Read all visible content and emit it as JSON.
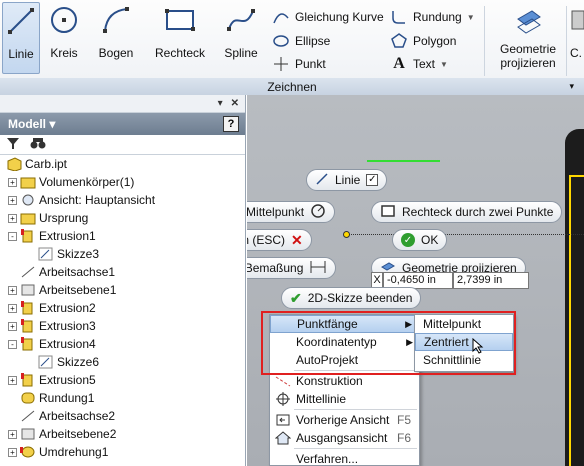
{
  "ribbon": {
    "big_buttons": [
      {
        "label": "Linie",
        "icon": "line-icon"
      },
      {
        "label": "Kreis",
        "icon": "circle-icon"
      },
      {
        "label": "Bogen",
        "icon": "arc-icon"
      },
      {
        "label": "Rechteck",
        "icon": "rectangle-icon"
      },
      {
        "label": "Spline",
        "icon": "spline-icon"
      }
    ],
    "small_buttons": [
      {
        "label": "Gleichung Kurve",
        "icon": "equation-curve-icon"
      },
      {
        "label": "Ellipse",
        "icon": "ellipse-icon"
      },
      {
        "label": "Punkt",
        "icon": "point-icon"
      },
      {
        "label": "Rundung",
        "icon": "fillet-icon"
      },
      {
        "label": "Polygon",
        "icon": "polygon-icon"
      },
      {
        "label": "Text",
        "icon": "text-icon"
      }
    ],
    "project_label_1": "Geometrie",
    "project_label_2": "projizieren",
    "cut_label": "C.",
    "panel_title": "Zeichnen"
  },
  "browser": {
    "title": "Modell",
    "tree": [
      {
        "label": "Carb.ipt",
        "icon": "part-icon",
        "level": 0,
        "expander": ""
      },
      {
        "label": "Volumenkörper(1)",
        "icon": "folder-icon",
        "level": 1,
        "expander": "+"
      },
      {
        "label": "Ansicht: Hauptansicht",
        "icon": "view-icon",
        "level": 1,
        "expander": "+"
      },
      {
        "label": "Ursprung",
        "icon": "folder-icon",
        "level": 1,
        "expander": "+"
      },
      {
        "label": "Extrusion1",
        "icon": "extrusion-icon",
        "level": 1,
        "expander": "-"
      },
      {
        "label": "Skizze3",
        "icon": "sketch-icon",
        "level": 2,
        "expander": ""
      },
      {
        "label": "Arbeitsachse1",
        "icon": "work-axis-icon",
        "level": 1,
        "expander": ""
      },
      {
        "label": "Arbeitsebene1",
        "icon": "work-plane-icon",
        "level": 1,
        "expander": "+"
      },
      {
        "label": "Extrusion2",
        "icon": "extrusion-icon",
        "level": 1,
        "expander": "+"
      },
      {
        "label": "Extrusion3",
        "icon": "extrusion-icon",
        "level": 1,
        "expander": "+"
      },
      {
        "label": "Extrusion4",
        "icon": "extrusion-icon",
        "level": 1,
        "expander": "-"
      },
      {
        "label": "Skizze6",
        "icon": "sketch-icon",
        "level": 2,
        "expander": ""
      },
      {
        "label": "Extrusion5",
        "icon": "extrusion-icon",
        "level": 1,
        "expander": "+"
      },
      {
        "label": "Rundung1",
        "icon": "fillet-feature-icon",
        "level": 1,
        "expander": ""
      },
      {
        "label": "Arbeitsachse2",
        "icon": "work-axis-icon",
        "level": 1,
        "expander": ""
      },
      {
        "label": "Arbeitsebene2",
        "icon": "work-plane-icon",
        "level": 1,
        "expander": "+"
      },
      {
        "label": "Umdrehung1",
        "icon": "revolve-icon",
        "level": 1,
        "expander": "+"
      }
    ]
  },
  "marking_menu": {
    "linie": "Linie",
    "kreis": "Kreis durch Mittelpunkt",
    "rechteck": "Rechteck durch zwei Punkte",
    "abbrechen": "Abbrechen (ESC)",
    "ok": "OK",
    "bemassung": "Allgemeine Bemaßung",
    "projizieren": "Geometrie projizieren",
    "beenden": "2D-Skizze beenden"
  },
  "dim_values": {
    "x": "X",
    "v1": "-0,4650 in",
    "v2": "2,7399 in"
  },
  "context_menu": {
    "items": [
      {
        "label": "Punktfänge",
        "submenu": true,
        "highlight": true
      },
      {
        "label": "Koordinatentyp",
        "submenu": true
      },
      {
        "label": "AutoProjekt"
      },
      {
        "label": "Konstruktion",
        "icon": "construction-icon"
      },
      {
        "label": "Mittellinie",
        "icon": "centerline-icon"
      },
      {
        "label": "Vorherige Ansicht",
        "shortcut": "F5",
        "icon": "previous-view-icon"
      },
      {
        "label": "Ausgangsansicht",
        "shortcut": "F6",
        "icon": "home-view-icon"
      },
      {
        "label": "Verfahren...",
        "icon": ""
      }
    ],
    "submenu": [
      {
        "label": "Mittelpunkt"
      },
      {
        "label": "Zentriert",
        "highlight": true
      },
      {
        "label": "Schnittlinie"
      }
    ]
  },
  "colors": {
    "accent": "#e02020",
    "highlight": "#b5d0ef",
    "sketch_green": "#33dd33",
    "yellow": "#ffd800"
  }
}
